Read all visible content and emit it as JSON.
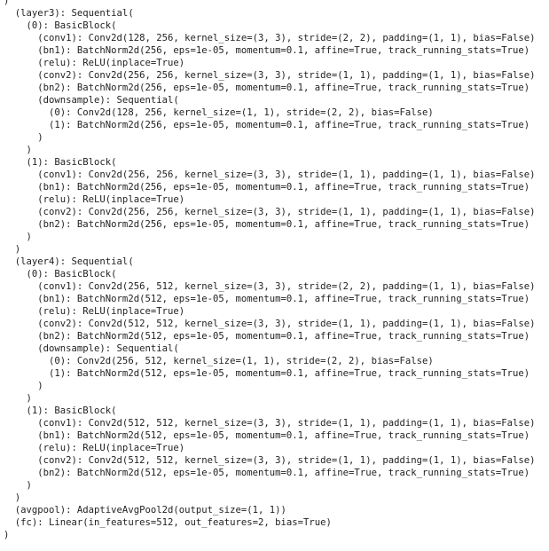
{
  "output": {
    "lines": [
      ")",
      "  (layer3): Sequential(",
      "    (0): BasicBlock(",
      "      (conv1): Conv2d(128, 256, kernel_size=(3, 3), stride=(2, 2), padding=(1, 1), bias=False)",
      "      (bn1): BatchNorm2d(256, eps=1e-05, momentum=0.1, affine=True, track_running_stats=True)",
      "      (relu): ReLU(inplace=True)",
      "      (conv2): Conv2d(256, 256, kernel_size=(3, 3), stride=(1, 1), padding=(1, 1), bias=False)",
      "      (bn2): BatchNorm2d(256, eps=1e-05, momentum=0.1, affine=True, track_running_stats=True)",
      "      (downsample): Sequential(",
      "        (0): Conv2d(128, 256, kernel_size=(1, 1), stride=(2, 2), bias=False)",
      "        (1): BatchNorm2d(256, eps=1e-05, momentum=0.1, affine=True, track_running_stats=True)",
      "      )",
      "    )",
      "    (1): BasicBlock(",
      "      (conv1): Conv2d(256, 256, kernel_size=(3, 3), stride=(1, 1), padding=(1, 1), bias=False)",
      "      (bn1): BatchNorm2d(256, eps=1e-05, momentum=0.1, affine=True, track_running_stats=True)",
      "      (relu): ReLU(inplace=True)",
      "      (conv2): Conv2d(256, 256, kernel_size=(3, 3), stride=(1, 1), padding=(1, 1), bias=False)",
      "      (bn2): BatchNorm2d(256, eps=1e-05, momentum=0.1, affine=True, track_running_stats=True)",
      "    )",
      "  )",
      "  (layer4): Sequential(",
      "    (0): BasicBlock(",
      "      (conv1): Conv2d(256, 512, kernel_size=(3, 3), stride=(2, 2), padding=(1, 1), bias=False)",
      "      (bn1): BatchNorm2d(512, eps=1e-05, momentum=0.1, affine=True, track_running_stats=True)",
      "      (relu): ReLU(inplace=True)",
      "      (conv2): Conv2d(512, 512, kernel_size=(3, 3), stride=(1, 1), padding=(1, 1), bias=False)",
      "      (bn2): BatchNorm2d(512, eps=1e-05, momentum=0.1, affine=True, track_running_stats=True)",
      "      (downsample): Sequential(",
      "        (0): Conv2d(256, 512, kernel_size=(1, 1), stride=(2, 2), bias=False)",
      "        (1): BatchNorm2d(512, eps=1e-05, momentum=0.1, affine=True, track_running_stats=True)",
      "      )",
      "    )",
      "    (1): BasicBlock(",
      "      (conv1): Conv2d(512, 512, kernel_size=(3, 3), stride=(1, 1), padding=(1, 1), bias=False)",
      "      (bn1): BatchNorm2d(512, eps=1e-05, momentum=0.1, affine=True, track_running_stats=True)",
      "      (relu): ReLU(inplace=True)",
      "      (conv2): Conv2d(512, 512, kernel_size=(3, 3), stride=(1, 1), padding=(1, 1), bias=False)",
      "      (bn2): BatchNorm2d(512, eps=1e-05, momentum=0.1, affine=True, track_running_stats=True)",
      "    )",
      "  )",
      "  (avgpool): AdaptiveAvgPool2d(output_size=(1, 1))",
      "  (fc): Linear(in_features=512, out_features=2, bias=True)",
      ")"
    ]
  }
}
